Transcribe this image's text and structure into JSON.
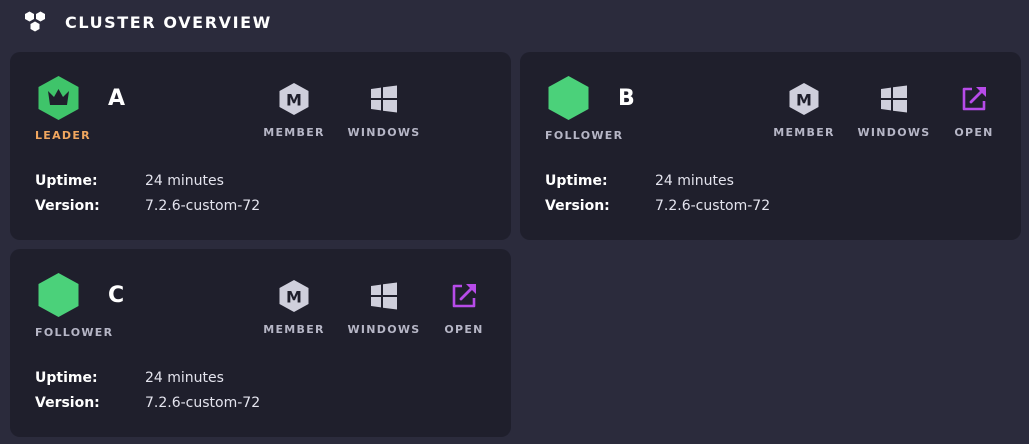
{
  "header": {
    "title": "CLUSTER OVERVIEW",
    "logo_icon": "cluster-hexagons-icon"
  },
  "colors": {
    "background": "#2b2b3c",
    "card": "#1f1f2c",
    "leader_green": "#3fc46a",
    "node_green": "#4bd17a",
    "leader_label": "#f0a65f",
    "open_purple": "#b74be9",
    "icon_grey": "#cfcfdc"
  },
  "cards": [
    {
      "name": "A",
      "role": "LEADER",
      "node_icon": "crown-hexagon-icon",
      "member_label": "MEMBER",
      "windows_label": "WINDOWS",
      "uptime_label": "Uptime:",
      "uptime_value": "24 minutes",
      "version_label": "Version:",
      "version_value": "7.2.6-custom-72"
    },
    {
      "name": "B",
      "role": "FOLLOWER",
      "node_icon": "hexagon-icon",
      "member_label": "MEMBER",
      "windows_label": "WINDOWS",
      "open_label": "OPEN",
      "uptime_label": "Uptime:",
      "uptime_value": "24 minutes",
      "version_label": "Version:",
      "version_value": "7.2.6-custom-72"
    },
    {
      "name": "C",
      "role": "FOLLOWER",
      "node_icon": "hexagon-icon",
      "member_label": "MEMBER",
      "windows_label": "WINDOWS",
      "open_label": "OPEN",
      "uptime_label": "Uptime:",
      "uptime_value": "24 minutes",
      "version_label": "Version:",
      "version_value": "7.2.6-custom-72"
    }
  ]
}
